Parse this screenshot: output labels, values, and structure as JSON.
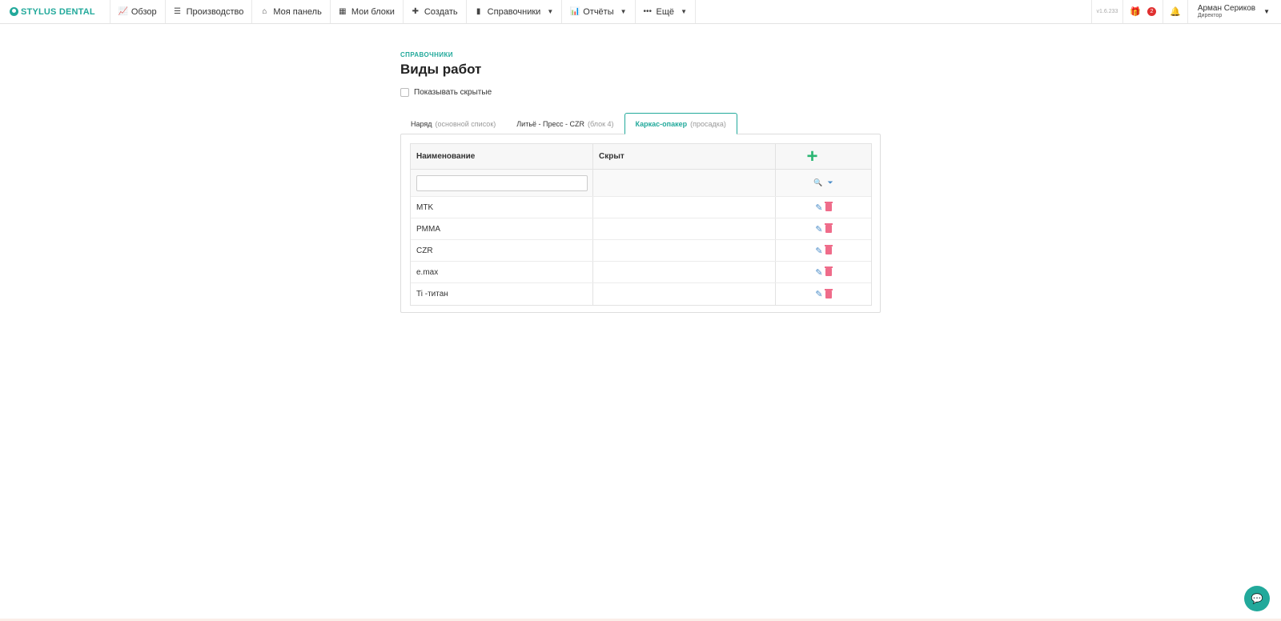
{
  "brand": {
    "name": "STYLUS DENTAL"
  },
  "nav": {
    "items": [
      {
        "label": "Обзор",
        "icon": "chart-line-icon",
        "glyph": "📈",
        "dropdown": false
      },
      {
        "label": "Производство",
        "icon": "list-icon",
        "glyph": "☰",
        "dropdown": false
      },
      {
        "label": "Моя панель",
        "icon": "home-icon",
        "glyph": "⌂",
        "dropdown": false
      },
      {
        "label": "Мои блоки",
        "icon": "grid-icon",
        "glyph": "▦",
        "dropdown": false
      },
      {
        "label": "Создать",
        "icon": "plus-icon",
        "glyph": "✚",
        "dropdown": false
      },
      {
        "label": "Справочники",
        "icon": "book-icon",
        "glyph": "▮",
        "dropdown": true
      },
      {
        "label": "Отчёты",
        "icon": "bar-chart-icon",
        "glyph": "📊",
        "dropdown": true
      },
      {
        "label": "Ещё",
        "icon": "more-dots-icon",
        "glyph": "•••",
        "dropdown": true
      }
    ],
    "version": "v1.6.233",
    "notifications_count": "2",
    "user": {
      "name": "Арман Сериков",
      "role": "Директор"
    }
  },
  "page": {
    "breadcrumb": "СПРАВОЧНИКИ",
    "title": "Виды работ",
    "show_hidden_label": "Показывать скрытые"
  },
  "tabs": [
    {
      "label": "Наряд",
      "sub": "(основной список)",
      "active": false
    },
    {
      "label": "Литьё - Пресс - CZR",
      "sub": "(блок 4)",
      "active": false
    },
    {
      "label": "Каркас-опакер",
      "sub": "(просадка)",
      "active": true
    }
  ],
  "table": {
    "columns": [
      "Наименование",
      "Скрыт"
    ],
    "rows": [
      {
        "name": "MTK",
        "hidden": ""
      },
      {
        "name": "PMMA",
        "hidden": ""
      },
      {
        "name": "CZR",
        "hidden": ""
      },
      {
        "name": "e.max",
        "hidden": ""
      },
      {
        "name": "Ti -титан",
        "hidden": ""
      }
    ]
  },
  "colors": {
    "accent": "#22a99b",
    "add": "#2bb673",
    "delete": "#ef6c8a",
    "edit": "#4a8cc8",
    "badge": "#e03030"
  }
}
